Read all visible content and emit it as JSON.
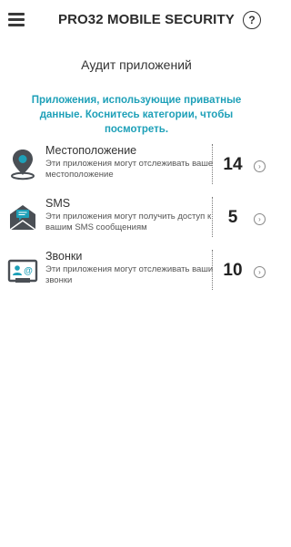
{
  "header": {
    "brand_prefix": "PRO32",
    "brand_suffix": " MOBILE SECURITY",
    "help_label": "?"
  },
  "page": {
    "title": "Аудит приложений",
    "subtitle": "Приложения, использующие приватные данные. Коснитесь категории, чтобы посмотреть."
  },
  "categories": [
    {
      "name": "Местоположение",
      "description": "Эти приложения могут отслеживать ваше местоположение",
      "count": "14",
      "icon": "location-pin-icon"
    },
    {
      "name": "SMS",
      "description": "Эти приложения могут получить доступ к вашим SMS сообщениям",
      "count": "5",
      "icon": "sms-envelope-icon"
    },
    {
      "name": "Звонки",
      "description": "Эти приложения могут отслеживать ваши звонки",
      "count": "10",
      "icon": "calls-contact-icon"
    }
  ],
  "colors": {
    "accent": "#1ea0b8",
    "icon": "#4a4f55"
  }
}
